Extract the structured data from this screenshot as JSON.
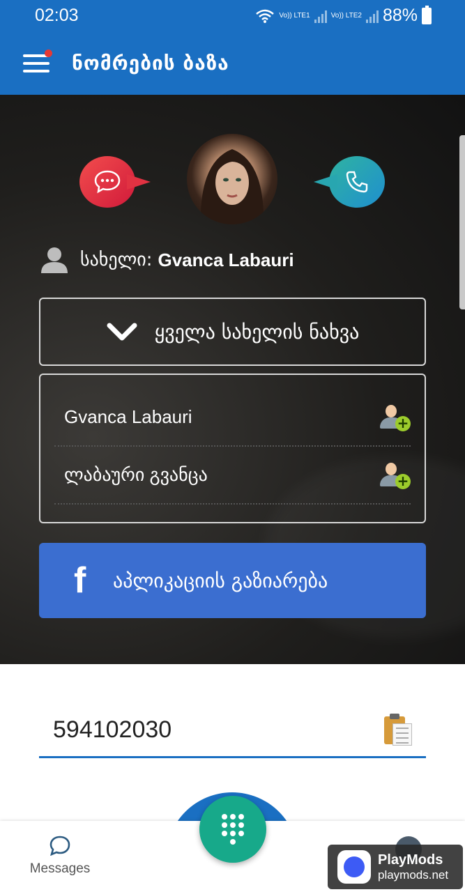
{
  "status_bar": {
    "time": "02:03",
    "sim1": "Vo)) LTE1",
    "sim2": "Vo)) LTE2",
    "battery": "88%"
  },
  "app_bar": {
    "title": "ნომრების ბაზა"
  },
  "profile": {
    "name_label": "სახელი:",
    "name_value": "Gvanca Labauri"
  },
  "all_names_button": {
    "label": "ყველა სახელის ნახვა",
    "icon": "chevron-down-icon"
  },
  "names": [
    {
      "text": "Gvanca Labauri"
    },
    {
      "text": "ლაბაური გვანცა"
    }
  ],
  "facebook_share": {
    "label": "აპლიკაციის გაზიარება"
  },
  "number_input": {
    "value": "594102030"
  },
  "bottom_nav": {
    "messages_label": "Messages"
  },
  "watermark": {
    "title": "PlayMods",
    "subtitle": "playmods.net"
  },
  "colors": {
    "primary": "#1a6fc2",
    "facebook": "#3b6ed0",
    "fab": "#17a98a",
    "message_bubble": "#e13242",
    "call_bubble": "#28a6b0"
  }
}
